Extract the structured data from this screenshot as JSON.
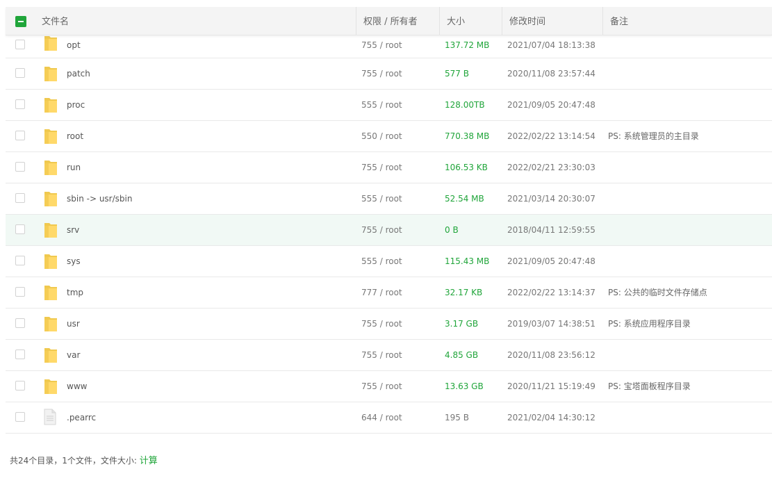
{
  "header": {
    "name": "文件名",
    "perm": "权限 / 所有者",
    "size": "大小",
    "mtime": "修改时间",
    "note": "备注"
  },
  "rows": [
    {
      "name": "opt",
      "type": "folder",
      "perm": "755 / root",
      "size": "137.72 MB",
      "mtime": "2021/07/04 18:13:38",
      "note": ""
    },
    {
      "name": "patch",
      "type": "folder",
      "perm": "755 / root",
      "size": "577 B",
      "mtime": "2020/11/08 23:57:44",
      "note": ""
    },
    {
      "name": "proc",
      "type": "folder",
      "perm": "555 / root",
      "size": "128.00TB",
      "mtime": "2021/09/05 20:47:48",
      "note": ""
    },
    {
      "name": "root",
      "type": "folder",
      "perm": "550 / root",
      "size": "770.38 MB",
      "mtime": "2022/02/22 13:14:54",
      "note": "PS: 系统管理员的主目录"
    },
    {
      "name": "run",
      "type": "folder",
      "perm": "755 / root",
      "size": "106.53 KB",
      "mtime": "2022/02/21 23:30:03",
      "note": ""
    },
    {
      "name": "sbin -> usr/sbin",
      "type": "folder",
      "perm": "555 / root",
      "size": "52.54 MB",
      "mtime": "2021/03/14 20:30:07",
      "note": ""
    },
    {
      "name": "srv",
      "type": "folder",
      "perm": "755 / root",
      "size": "0 B",
      "mtime": "2018/04/11 12:59:55",
      "note": ""
    },
    {
      "name": "sys",
      "type": "folder",
      "perm": "555 / root",
      "size": "115.43 MB",
      "mtime": "2021/09/05 20:47:48",
      "note": ""
    },
    {
      "name": "tmp",
      "type": "folder",
      "perm": "777 / root",
      "size": "32.17 KB",
      "mtime": "2022/02/22 13:14:37",
      "note": "PS: 公共的临时文件存储点"
    },
    {
      "name": "usr",
      "type": "folder",
      "perm": "755 / root",
      "size": "3.17 GB",
      "mtime": "2019/03/07 14:38:51",
      "note": "PS: 系统应用程序目录"
    },
    {
      "name": "var",
      "type": "folder",
      "perm": "755 / root",
      "size": "4.85 GB",
      "mtime": "2020/11/08 23:56:12",
      "note": ""
    },
    {
      "name": "www",
      "type": "folder",
      "perm": "755 / root",
      "size": "13.63 GB",
      "mtime": "2020/11/21 15:19:49",
      "note": "PS: 宝塔面板程序目录"
    },
    {
      "name": ".pearrc",
      "type": "file",
      "perm": "644 / root",
      "size": "195 B",
      "mtime": "2021/02/04 14:30:12",
      "note": ""
    }
  ],
  "hover_row": 6,
  "footer": {
    "summary": "共24个目录，1个文件，文件大小: ",
    "calc_link": "计算"
  },
  "colors": {
    "accent": "#20a53a",
    "hover": "#f1f9f5"
  }
}
